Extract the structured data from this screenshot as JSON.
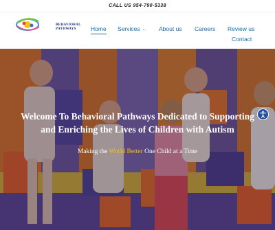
{
  "topbar": {
    "phone_text": "CALL US  954-790-5338"
  },
  "logo": {
    "line1": "BEHAVIORAL",
    "line2": "PATHWAYS"
  },
  "nav": {
    "home": "Home",
    "services": "Services",
    "about": "About us",
    "careers": "Careers",
    "reviews": "Review us",
    "contact": "Contact"
  },
  "hero": {
    "title_line1": "Welcome To Behavioral Pathways Dedicated to Supporting",
    "title_line2": "and Enriching the Lives of Children with Autism",
    "sub_part1": "Making the ",
    "sub_highlight": "World Better",
    "sub_part2": " One Child at a Time"
  },
  "icons": {
    "accessibility": "accessibility-icon",
    "services_dropdown": "chevron-down-icon"
  },
  "colors": {
    "nav_link": "#1a6aa8",
    "highlight": "#f3c316",
    "access_button": "#1f4fa0"
  }
}
